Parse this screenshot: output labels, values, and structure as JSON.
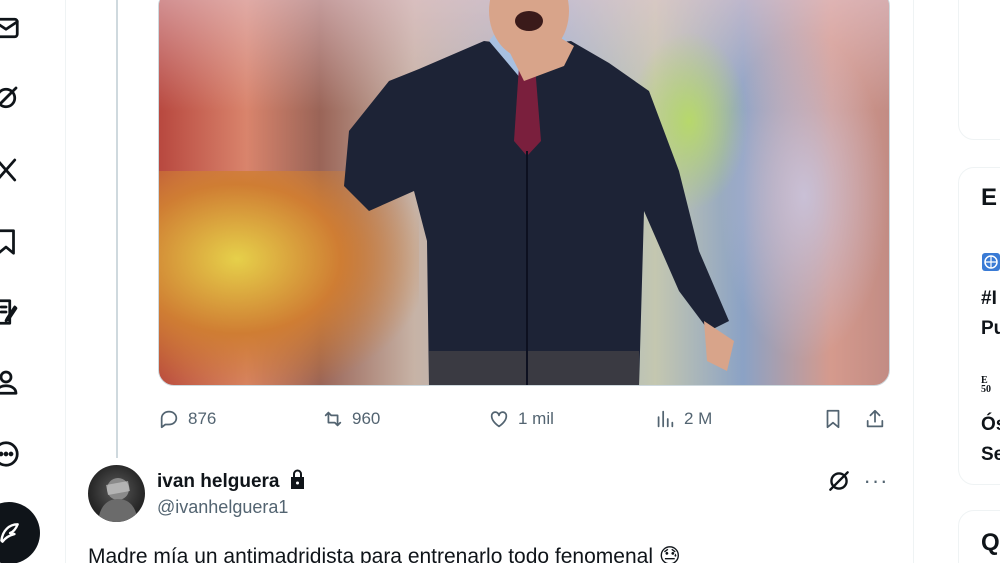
{
  "nav": {
    "items": [
      {
        "icon": "mail-icon"
      },
      {
        "icon": "grok-icon"
      },
      {
        "icon": "x-logo-icon"
      },
      {
        "icon": "bookmark-icon"
      },
      {
        "icon": "lists-icon"
      },
      {
        "icon": "profile-icon"
      },
      {
        "icon": "more-circle-icon"
      }
    ],
    "post_button_icon": "feather-icon"
  },
  "tweet": {
    "media_description_icon": "photo",
    "actions": {
      "replies": "876",
      "reposts": "960",
      "likes": "1 mil",
      "views": "2 M"
    }
  },
  "reply": {
    "display_name": "ivan helguera",
    "handle": "@ivanhelguera1",
    "text": "Madre mía un antimadridista para entrenarlo todo fenomenal 😓",
    "protected": true
  },
  "sidebar": {
    "card2": {
      "heading_fragment": "E",
      "item1_line1": "#I",
      "item1_line2": "Pu",
      "item2_badge": "E\n50",
      "item2_line1": "Ós",
      "item2_line2": "Se"
    },
    "card3": {
      "heading_fragment": "Q"
    }
  },
  "colors": {
    "text": "#0f1419",
    "secondary": "#536471",
    "border": "#eff3f4"
  }
}
